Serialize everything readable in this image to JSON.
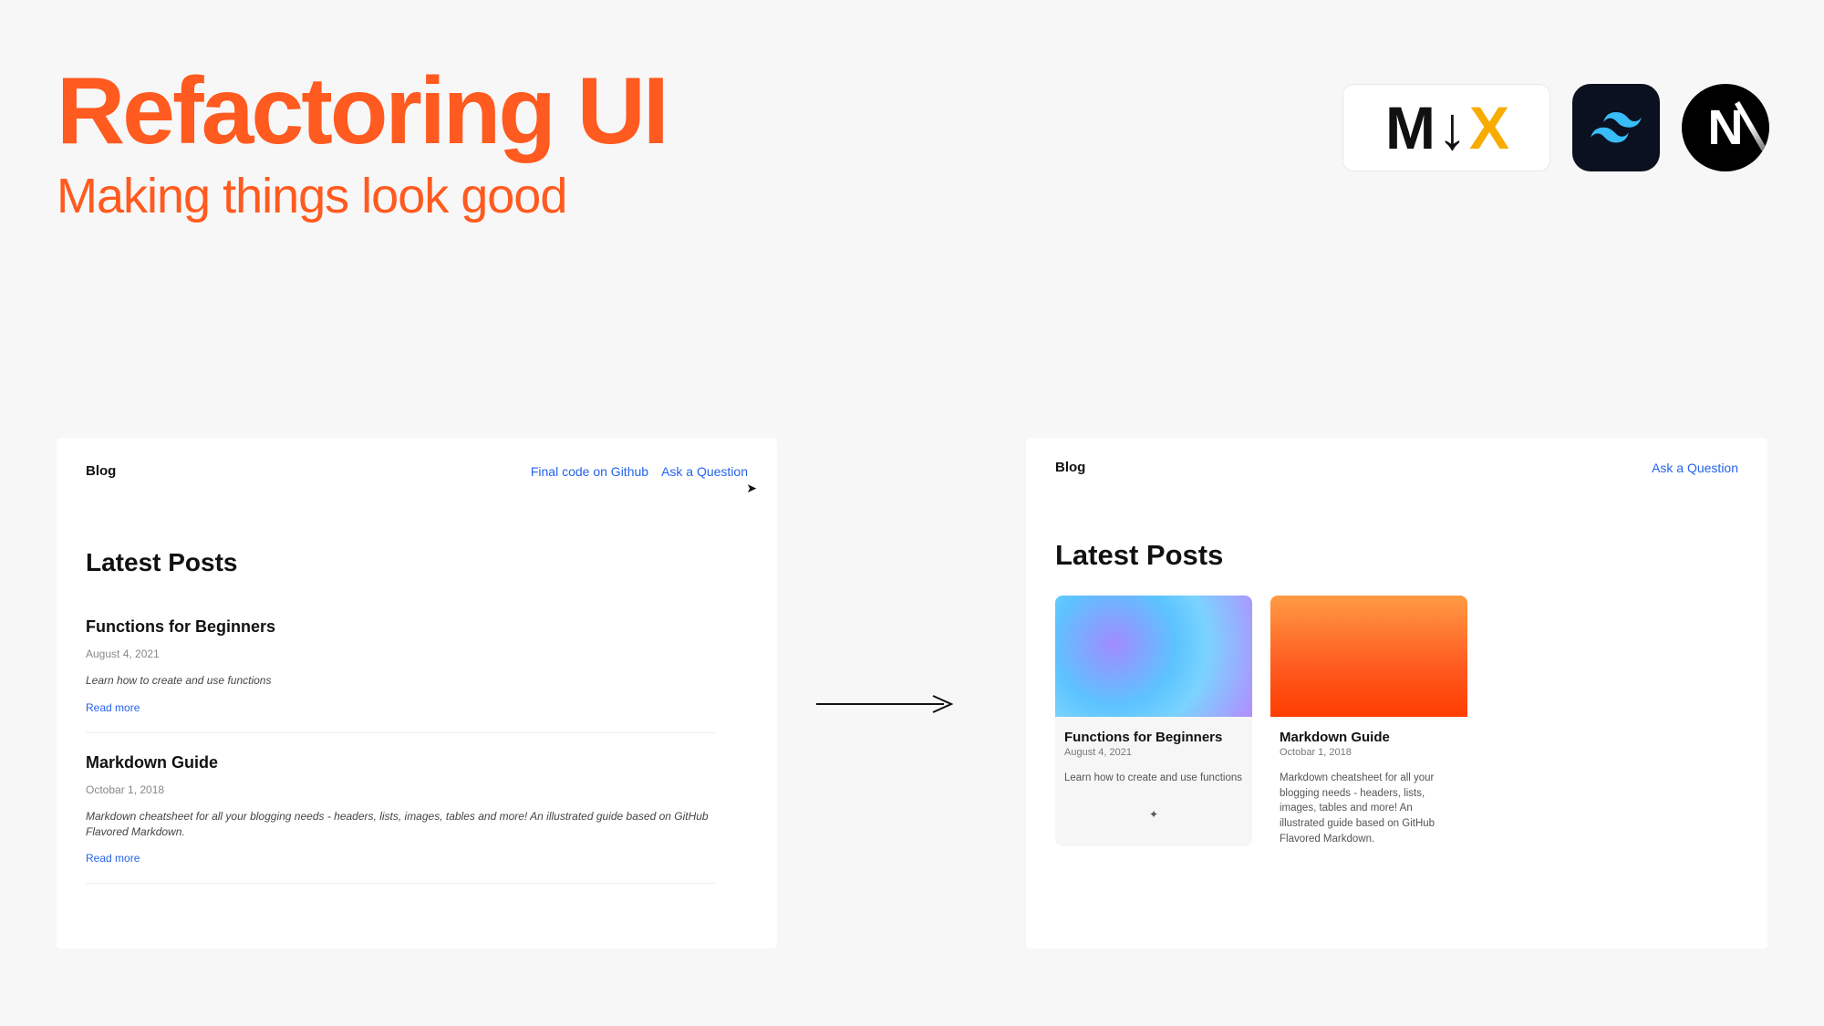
{
  "header": {
    "title": "Refactoring UI",
    "subtitle": "Making things look good"
  },
  "logos": {
    "mdx_m": "M",
    "mdx_arrow": "↓",
    "mdx_x": "X"
  },
  "before": {
    "brand": "Blog",
    "nav": {
      "github": "Final code on Github",
      "ask": "Ask a Question"
    },
    "heading": "Latest Posts",
    "posts": [
      {
        "title": "Functions for Beginners",
        "date": "August 4, 2021",
        "excerpt": "Learn how to create and use functions",
        "read_more": "Read more"
      },
      {
        "title": "Markdown Guide",
        "date": "Octobar 1, 2018",
        "excerpt": "Markdown cheatsheet for all your blogging needs - headers, lists, images, tables and more! An illustrated guide based on GitHub Flavored Markdown.",
        "read_more": "Read more"
      }
    ]
  },
  "after": {
    "brand": "Blog",
    "nav": {
      "ask": "Ask a Question"
    },
    "heading": "Latest Posts",
    "cards": [
      {
        "title": "Functions for Beginners",
        "date": "August 4, 2021",
        "excerpt": "Learn how to create and use functions"
      },
      {
        "title": "Markdown Guide",
        "date": "Octobar 1, 2018",
        "excerpt": "Markdown cheatsheet for all your blogging needs - headers, lists, images, tables and more! An illustrated guide based on GitHub Flavored Markdown."
      }
    ]
  },
  "colors": {
    "accent": "#ff5a1f",
    "link": "#2563eb"
  }
}
